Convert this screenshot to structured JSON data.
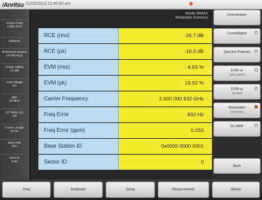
{
  "status_bar": {
    "brand": "/Anritsu",
    "timestamp": "02/05/2013 11:45:50 am"
  },
  "measurement": {
    "title_line1": "Mobile WiMAX",
    "title_line2": "Modulation Summary"
  },
  "left_panel": [
    {
      "title": "Center Freq",
      "value": "2.500 GHz"
    },
    {
      "title": "Channel",
      "value": ""
    },
    {
      "title": "Reference Source",
      "value": "Int Std Accy"
    },
    {
      "title": "Power Offset",
      "value": "0.0 dB"
    },
    {
      "title": "Auto Range",
      "value": "On"
    },
    {
      "title": "BW",
      "value": "10 MHz"
    },
    {
      "title": "CP Ratio (G)",
      "value": "1/8"
    },
    {
      "title": "Frame Length",
      "value": "10 ms"
    },
    {
      "title": "Max Hold",
      "value": "N/A"
    },
    {
      "title": "Demod",
      "value": "Auto"
    }
  ],
  "results": [
    {
      "label": "RCE (rms)",
      "value": "-26.7 dB"
    },
    {
      "label": "RCE (pk)",
      "value": "-16.0 dB"
    },
    {
      "label": "EVM (rms)",
      "value": "4.63 %"
    },
    {
      "label": "EVM (pk)",
      "value": "15.92 %"
    },
    {
      "label": "Carrier Frequency",
      "value": "2.500 000 632 GHz"
    },
    {
      "label": "Freq Error",
      "value": "632 Hz"
    },
    {
      "label": "Freq Error (ppm)",
      "value": "0.253"
    },
    {
      "label": "Base Station ID",
      "value": "0x0000 0000 0001"
    },
    {
      "label": "Sector ID",
      "value": "0"
    }
  ],
  "soft_keys": [
    {
      "label": "Demodulator",
      "sub": ""
    },
    {
      "label": "Constellation",
      "sub": ""
    },
    {
      "label": "Spectral Flatness",
      "sub": ""
    },
    {
      "label": "EVM vs",
      "sub": "Sub Carrier"
    },
    {
      "label": "EVM vs",
      "sub": "Symbol"
    },
    {
      "label": "Modulation",
      "sub": "Summary"
    },
    {
      "label": "DL-MAP",
      "sub": ""
    },
    {
      "label": "Back",
      "sub": ""
    }
  ],
  "bottom_menu": [
    "Freq",
    "Amplitude",
    "Setup",
    "Measurements",
    "Marker"
  ]
}
